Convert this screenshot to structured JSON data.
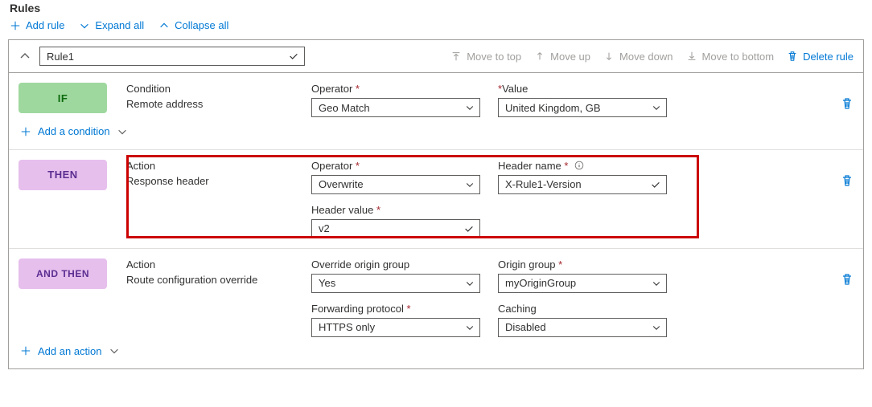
{
  "section": {
    "title": "Rules"
  },
  "toolbar": {
    "add_rule": "Add rule",
    "expand_all": "Expand all",
    "collapse_all": "Collapse all"
  },
  "rule": {
    "name": "Rule1",
    "header": {
      "move_top": "Move to top",
      "move_up": "Move up",
      "move_down": "Move down",
      "move_bottom": "Move to bottom",
      "delete": "Delete rule"
    },
    "if": {
      "pill": "IF",
      "condition_label": "Condition",
      "condition_value": "Remote address",
      "operator_label": "Operator",
      "operator_value": "Geo Match",
      "value_label": "Value",
      "value_value": "United Kingdom, GB",
      "add_condition": "Add a condition"
    },
    "then": {
      "pill": "THEN",
      "action_label": "Action",
      "action_value": "Response header",
      "operator_label": "Operator",
      "operator_value": "Overwrite",
      "header_name_label": "Header name",
      "header_name_value": "X-Rule1-Version",
      "header_value_label": "Header value",
      "header_value_value": "v2"
    },
    "andthen": {
      "pill": "AND THEN",
      "action_label": "Action",
      "action_value": "Route configuration override",
      "override_label": "Override origin group",
      "override_value": "Yes",
      "origin_label": "Origin group",
      "origin_value": "myOriginGroup",
      "fwd_label": "Forwarding protocol",
      "fwd_value": "HTTPS only",
      "caching_label": "Caching",
      "caching_value": "Disabled",
      "add_action": "Add an action"
    }
  }
}
